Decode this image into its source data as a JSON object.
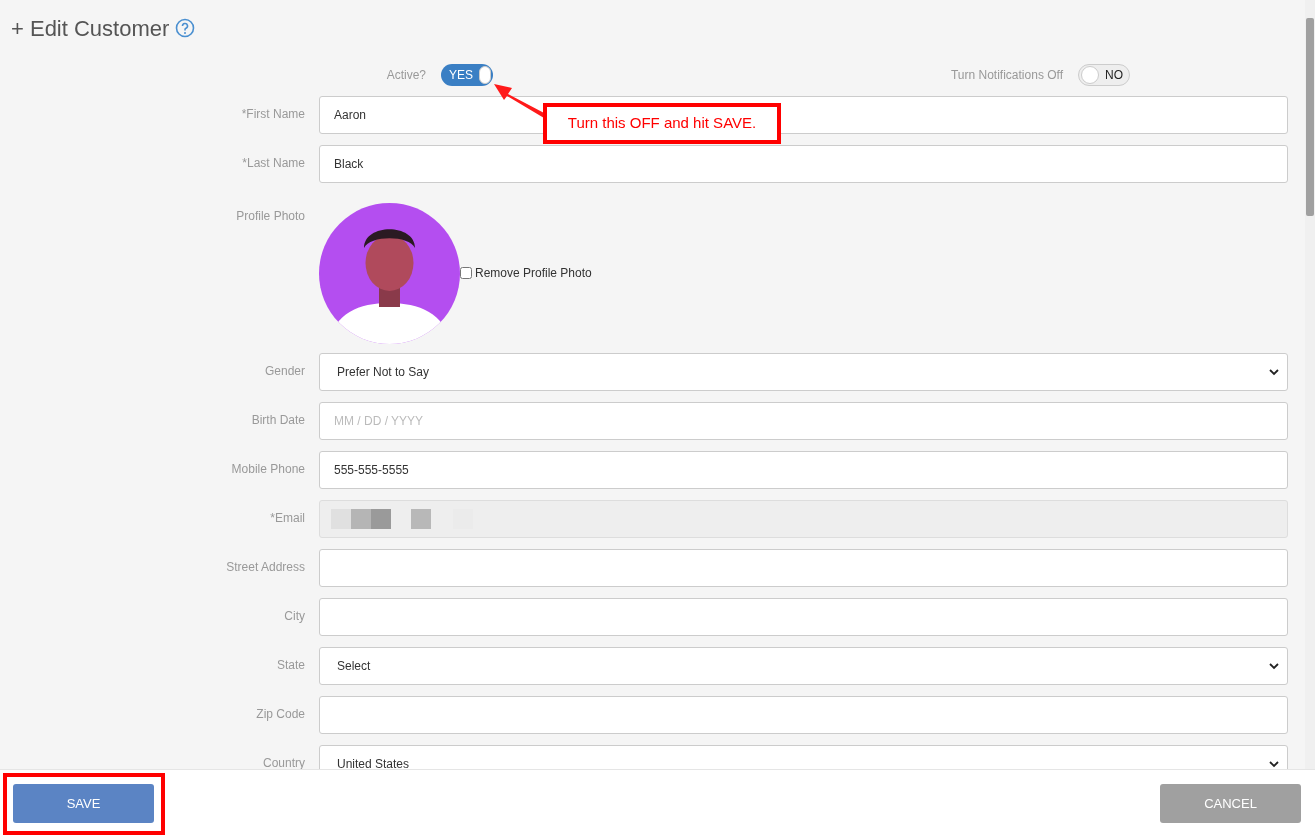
{
  "title": "+ Edit Customer",
  "toggles": [
    {
      "label": "Active?",
      "on": true,
      "text": "YES"
    },
    {
      "label": "Turn Notifications Off",
      "on": false,
      "text": "NO"
    }
  ],
  "fields": [
    {
      "kind": "text",
      "label": "*First Name",
      "value": "Aaron"
    },
    {
      "kind": "text",
      "label": "*Last Name",
      "value": "Black"
    },
    {
      "kind": "photo",
      "label": "Profile Photo",
      "checkbox_label": "Remove Profile Photo",
      "checked": false
    },
    {
      "kind": "select",
      "label": "Gender",
      "value": "Prefer Not to Say"
    },
    {
      "kind": "text",
      "label": "Birth Date",
      "placeholder": "MM / DD / YYYY"
    },
    {
      "kind": "text",
      "label": "Mobile Phone",
      "value": "555-555-5555"
    },
    {
      "kind": "redacted",
      "label": "*Email"
    },
    {
      "kind": "text",
      "label": "Street Address"
    },
    {
      "kind": "text",
      "label": "City"
    },
    {
      "kind": "select",
      "label": "State",
      "value": "Select"
    },
    {
      "kind": "text",
      "label": "Zip Code"
    },
    {
      "kind": "select",
      "label": "Country",
      "value": "United States"
    }
  ],
  "annotation": {
    "text": "Turn this OFF and hit SAVE."
  },
  "buttons": [
    {
      "kind": "save",
      "label": "SAVE"
    },
    {
      "kind": "cancel",
      "label": "CANCEL"
    }
  ]
}
